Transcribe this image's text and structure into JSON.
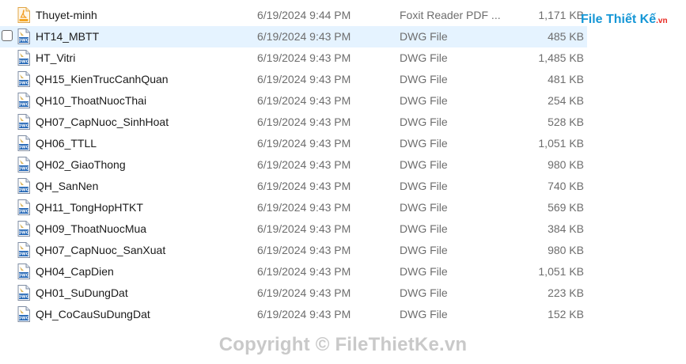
{
  "brand": {
    "logo_text": "File Thiết Kế",
    "logo_domain": ".vn"
  },
  "watermark": "Copyright © FileThietKe.vn",
  "colors": {
    "hover_row": "#e5f3ff",
    "pdf_icon": "#f5a623",
    "dwg_icon": "#1e63b4"
  },
  "files": [
    {
      "name": "Thuyet-minh",
      "date": "6/19/2024 9:44 PM",
      "type": "Foxit Reader PDF ...",
      "size": "1,171 KB",
      "icon": "pdf-file-icon"
    },
    {
      "name": "HT14_MBTT",
      "date": "6/19/2024 9:43 PM",
      "type": "DWG File",
      "size": "485 KB",
      "icon": "dwg-file-icon",
      "hovered": true
    },
    {
      "name": "HT_Vitri",
      "date": "6/19/2024 9:43 PM",
      "type": "DWG File",
      "size": "1,485 KB",
      "icon": "dwg-file-icon"
    },
    {
      "name": "QH15_KienTrucCanhQuan",
      "date": "6/19/2024 9:43 PM",
      "type": "DWG File",
      "size": "481 KB",
      "icon": "dwg-file-icon"
    },
    {
      "name": "QH10_ThoatNuocThai",
      "date": "6/19/2024 9:43 PM",
      "type": "DWG File",
      "size": "254 KB",
      "icon": "dwg-file-icon"
    },
    {
      "name": "QH07_CapNuoc_SinhHoat",
      "date": "6/19/2024 9:43 PM",
      "type": "DWG File",
      "size": "528 KB",
      "icon": "dwg-file-icon"
    },
    {
      "name": "QH06_TTLL",
      "date": "6/19/2024 9:43 PM",
      "type": "DWG File",
      "size": "1,051 KB",
      "icon": "dwg-file-icon"
    },
    {
      "name": "QH02_GiaoThong",
      "date": "6/19/2024 9:43 PM",
      "type": "DWG File",
      "size": "980 KB",
      "icon": "dwg-file-icon"
    },
    {
      "name": "QH_SanNen",
      "date": "6/19/2024 9:43 PM",
      "type": "DWG File",
      "size": "740 KB",
      "icon": "dwg-file-icon"
    },
    {
      "name": "QH11_TongHopHTKT",
      "date": "6/19/2024 9:43 PM",
      "type": "DWG File",
      "size": "569 KB",
      "icon": "dwg-file-icon"
    },
    {
      "name": "QH09_ThoatNuocMua",
      "date": "6/19/2024 9:43 PM",
      "type": "DWG File",
      "size": "384 KB",
      "icon": "dwg-file-icon"
    },
    {
      "name": "QH07_CapNuoc_SanXuat",
      "date": "6/19/2024 9:43 PM",
      "type": "DWG File",
      "size": "980 KB",
      "icon": "dwg-file-icon"
    },
    {
      "name": "QH04_CapDien",
      "date": "6/19/2024 9:43 PM",
      "type": "DWG File",
      "size": "1,051 KB",
      "icon": "dwg-file-icon"
    },
    {
      "name": "QH01_SuDungDat",
      "date": "6/19/2024 9:43 PM",
      "type": "DWG File",
      "size": "223 KB",
      "icon": "dwg-file-icon"
    },
    {
      "name": "QH_CoCauSuDungDat",
      "date": "6/19/2024 9:43 PM",
      "type": "DWG File",
      "size": "152 KB",
      "icon": "dwg-file-icon"
    }
  ]
}
